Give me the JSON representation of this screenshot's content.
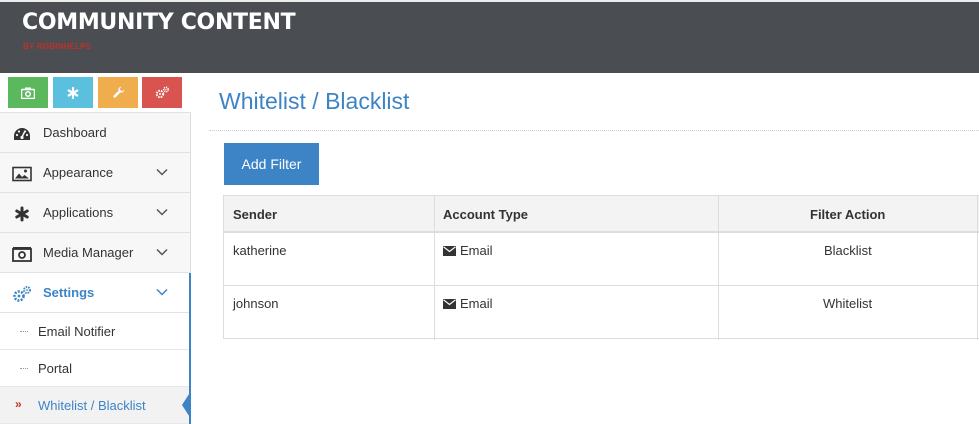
{
  "header": {
    "title": "COMMUNITY CONTENT",
    "subtitle": "BY ROBINHELPS",
    "background": "#4a4d52"
  },
  "shortcuts": [
    {
      "icon": "camera-icon",
      "color": "#5cb85c"
    },
    {
      "icon": "asterisk-icon",
      "color": "#5bc0de"
    },
    {
      "icon": "wrench-icon",
      "color": "#f0ad4e"
    },
    {
      "icon": "gears-icon",
      "color": "#d9534f"
    }
  ],
  "sidebar": {
    "items": [
      {
        "label": "Dashboard",
        "icon": "dashboard-icon"
      },
      {
        "label": "Appearance",
        "icon": "picture-icon"
      },
      {
        "label": "Applications",
        "icon": "asterisk-icon"
      },
      {
        "label": "Media Manager",
        "icon": "camera-icon"
      },
      {
        "label": "Settings",
        "icon": "gears-icon"
      }
    ],
    "subitems": [
      {
        "label": "Email Notifier"
      },
      {
        "label": "Portal"
      },
      {
        "label": "Whitelist / Blacklist"
      }
    ],
    "accent": "#3d84c6"
  },
  "main": {
    "title": "Whitelist / Blacklist",
    "add_filter_label": "Add Filter",
    "table": {
      "headers": [
        "Sender",
        "Account Type",
        "Filter Action"
      ],
      "rows": [
        {
          "sender": "katherine",
          "account_type": "Email",
          "filter_action": "Blacklist"
        },
        {
          "sender": "johnson",
          "account_type": "Email",
          "filter_action": "Whitelist"
        }
      ]
    }
  }
}
